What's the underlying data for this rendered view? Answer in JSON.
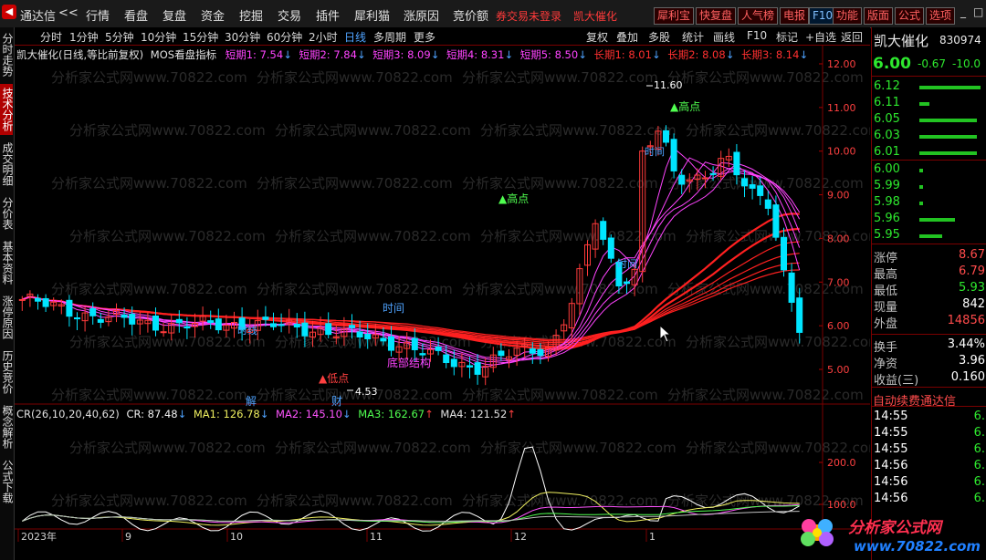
{
  "menubar": {
    "app_name": "通达信",
    "back_label": "<<",
    "menus": [
      "行情",
      "看盘",
      "复盘",
      "资金",
      "挖掘",
      "交易",
      "插件",
      "犀利猫",
      "涨原因",
      "竞价额"
    ],
    "warning": "券交易未登录",
    "stock_tab": "凯大催化",
    "right_buttons": [
      "犀利宝",
      "快复盘",
      "人气榜",
      "电报",
      "F10",
      "功能",
      "版面",
      "公式",
      "选项"
    ],
    "window_controls": [
      "_",
      "□",
      "×"
    ]
  },
  "left_tabs": [
    {
      "label": "分时走势",
      "active": false
    },
    {
      "label": "技术分析",
      "active": true
    },
    {
      "label": "成交明细",
      "active": false
    },
    {
      "label": "分价表",
      "active": false
    },
    {
      "label": "基本资料",
      "active": false
    },
    {
      "label": "涨停原因",
      "active": false
    },
    {
      "label": "历史竞价",
      "active": false
    },
    {
      "label": "概念解析",
      "active": false
    },
    {
      "label": "公式下载",
      "active": false
    }
  ],
  "period_bar": {
    "periods": [
      "分时",
      "1分钟",
      "5分钟",
      "10分钟",
      "15分钟",
      "30分钟",
      "60分钟",
      "2小时",
      "日线",
      "多周期",
      "更多"
    ],
    "selected": "日线",
    "tools": [
      "复权",
      "叠加",
      "多股",
      "统计",
      "画线",
      "F10",
      "标记",
      "+自选",
      "返回"
    ]
  },
  "main_chart": {
    "header": "凯大催化(日线,等比前复权)",
    "indicator_name": "MOS看盘指标",
    "short_periods": [
      {
        "label": "短期1: 7.54",
        "arrow": "↓"
      },
      {
        "label": "短期2: 7.84",
        "arrow": "↓"
      },
      {
        "label": "短期3: 8.09",
        "arrow": "↓"
      },
      {
        "label": "短期4: 8.31",
        "arrow": "↓"
      },
      {
        "label": "短期5: 8.50",
        "arrow": "↓"
      }
    ],
    "long_periods": [
      {
        "label": "长期1: 8.01",
        "arrow": "↓"
      },
      {
        "label": "长期2: 8.08",
        "arrow": "↓"
      },
      {
        "label": "长期3: 8.14",
        "arrow": "↓"
      }
    ],
    "price_axis": [
      "12.00",
      "11.00",
      "10.00",
      "9.00",
      "8.00",
      "7.00",
      "6.00",
      "5.00"
    ],
    "annotations": {
      "high_price": "11.60",
      "low_price": "4.53",
      "high_point_1": "▲高点",
      "high_point_2": "▲高点",
      "buy_point": "▲低点",
      "bottom_structure": "底部结构",
      "time_label": "时间",
      "event_1": "解",
      "event_2": "财",
      "mark_1": "时线",
      "mark_2": "时间",
      "mark_3": "时间"
    },
    "watermark_text": "分析家公式网www.70822.com"
  },
  "cr_indicator": {
    "name": "CR(26,10,20,40,62)",
    "cr": "CR: 87.48",
    "cr_arrow": "↓",
    "ma1": "MA1: 126.78",
    "ma1_arrow": "↓",
    "ma2": "MA2: 145.10",
    "ma2_arrow": "↓",
    "ma3": "MA3: 162.67",
    "ma3_arrow": "↑",
    "ma4": "MA4: 121.52",
    "ma4_arrow": "↑",
    "axis": [
      "200.0",
      "100.0"
    ]
  },
  "x_axis": [
    "2023年",
    "9",
    "10",
    "11",
    "12",
    "1"
  ],
  "right_panel": {
    "name": "凯大催化",
    "code": "830974",
    "price": "6.00",
    "change": "-0.67",
    "pct": "-10.0",
    "asks": [
      {
        "price": "6.12",
        "bar": 0.95
      },
      {
        "price": "6.11",
        "bar": 0.15
      },
      {
        "price": "6.05",
        "bar": 0.9
      },
      {
        "price": "6.03",
        "bar": 0.9
      },
      {
        "price": "6.01",
        "bar": 0.9
      }
    ],
    "bids": [
      {
        "price": "6.00",
        "bar": 0.05
      },
      {
        "price": "5.99",
        "bar": 0.05
      },
      {
        "price": "5.98",
        "bar": 0.05
      },
      {
        "price": "5.96",
        "bar": 0.55
      },
      {
        "price": "5.95",
        "bar": 0.35
      }
    ],
    "stats": [
      {
        "label": "涨停",
        "value": "8.67"
      },
      {
        "label": "最高",
        "value": "6.79"
      },
      {
        "label": "最低",
        "value": "5.93"
      },
      {
        "label": "现量",
        "value": "842"
      },
      {
        "label": "外盘",
        "value": "14856"
      }
    ],
    "stats2": [
      {
        "label": "换手",
        "value": "3.44%"
      },
      {
        "label": "净资",
        "value": "3.96"
      },
      {
        "label": "收益(三)",
        "value": "0.160"
      }
    ],
    "promo": "自动续费通达信",
    "ticks": [
      "14:55",
      "14:55",
      "14:55",
      "14:56",
      "14:56",
      "14:56"
    ],
    "tick_values": [
      "6.",
      "6.",
      "6.",
      "6.",
      "6.",
      "6."
    ]
  },
  "logo": {
    "text": "分析家公式网",
    "url": "www.70822.com"
  },
  "colors": {
    "up": "#ff3b3b",
    "down": "#00e5ff",
    "long_ma": "#ff2020",
    "short_ma": "#ff44ff"
  }
}
